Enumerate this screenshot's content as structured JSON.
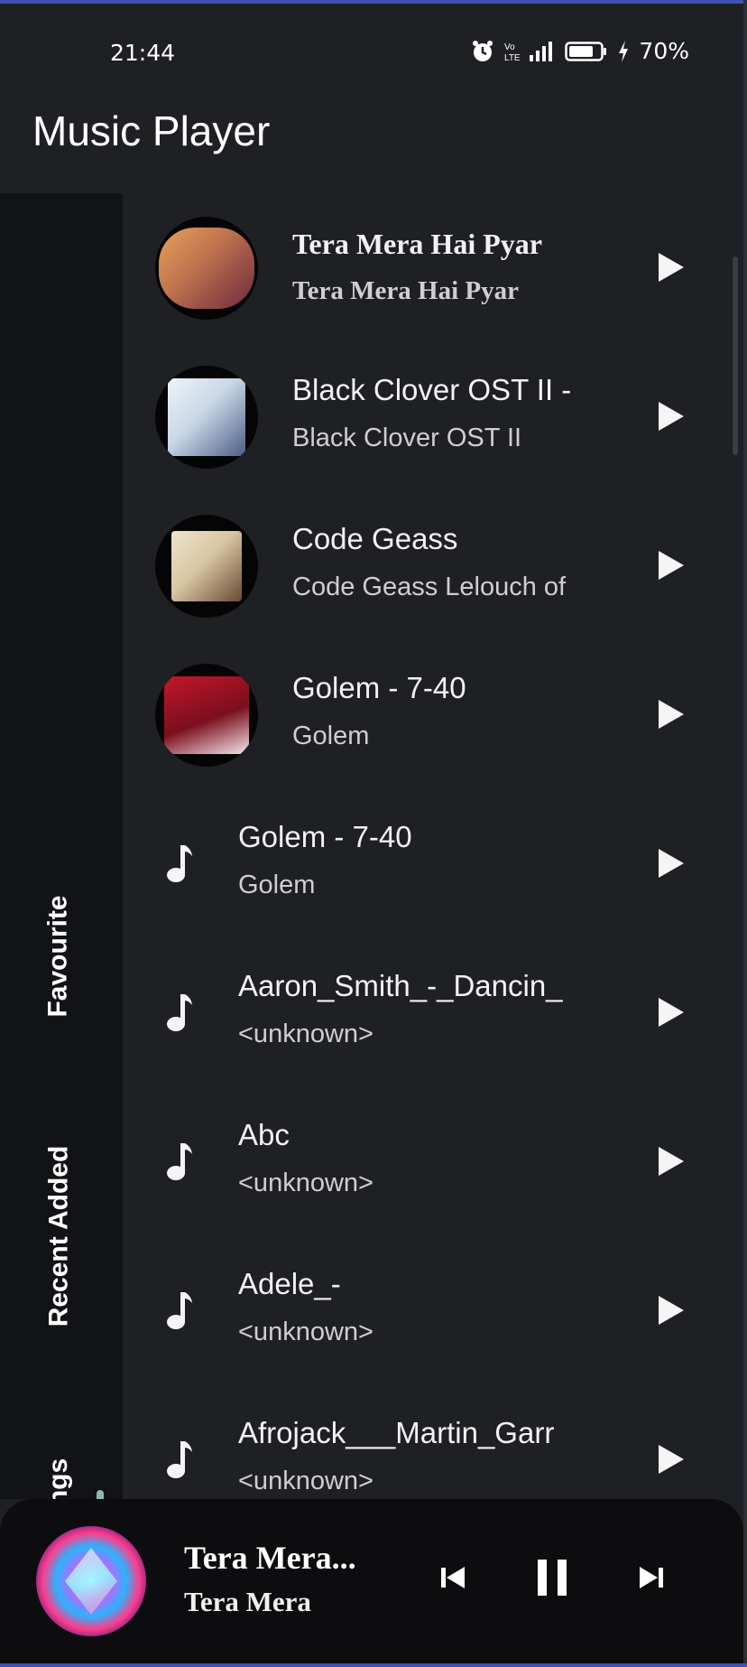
{
  "status_bar": {
    "time": "21:44",
    "battery_pct": "70%",
    "icons": [
      "alarm-icon",
      "volte-icon",
      "signal-icon",
      "battery-icon",
      "charging-icon"
    ]
  },
  "app": {
    "title": "Music Player"
  },
  "sidebar": {
    "tabs": [
      {
        "label": "Favourite"
      },
      {
        "label": "Recent Added"
      },
      {
        "label": "All Songs",
        "active": true
      }
    ]
  },
  "songs": [
    {
      "title": "Tera Mera Hai Pyar",
      "subtitle": "Tera Mera Hai Pyar",
      "icon": "album-art",
      "colors": [
        "#c2754f",
        "#6e2a3d"
      ]
    },
    {
      "title": "Black Clover OST II -",
      "subtitle": "Black Clover OST II",
      "icon": "album-art",
      "colors": [
        "#c7d6e6",
        "#4d5d86"
      ]
    },
    {
      "title": "Code Geass",
      "subtitle": "Code Geass Lelouch of",
      "icon": "album-art",
      "colors": [
        "#d8c6a2",
        "#6a4a35"
      ]
    },
    {
      "title": "Golem - 7-40",
      "subtitle": "Golem",
      "icon": "album-art",
      "colors": [
        "#c4162b",
        "#f3e6ea"
      ]
    },
    {
      "title": "Golem - 7-40",
      "subtitle": "Golem",
      "icon": "music-note-icon"
    },
    {
      "title": "Aaron_Smith_-_Dancin_",
      "subtitle": "<unknown>",
      "icon": "music-note-icon"
    },
    {
      "title": "Abc",
      "subtitle": "<unknown>",
      "icon": "music-note-icon"
    },
    {
      "title": "Adele_-",
      "subtitle": "<unknown>",
      "icon": "music-note-icon"
    },
    {
      "title": "Afrojack___Martin_Garr",
      "subtitle": "<unknown>",
      "icon": "music-note-icon"
    }
  ],
  "now_playing": {
    "title": "Tera Mera...",
    "artist": "Tera Mera",
    "controls": [
      "previous-icon",
      "pause-icon",
      "next-icon"
    ]
  },
  "colors": {
    "background": "#1f2024",
    "sidebar": "#121316",
    "active_indicator": "#8fb9ab",
    "mini_player": "#0d0d10"
  }
}
